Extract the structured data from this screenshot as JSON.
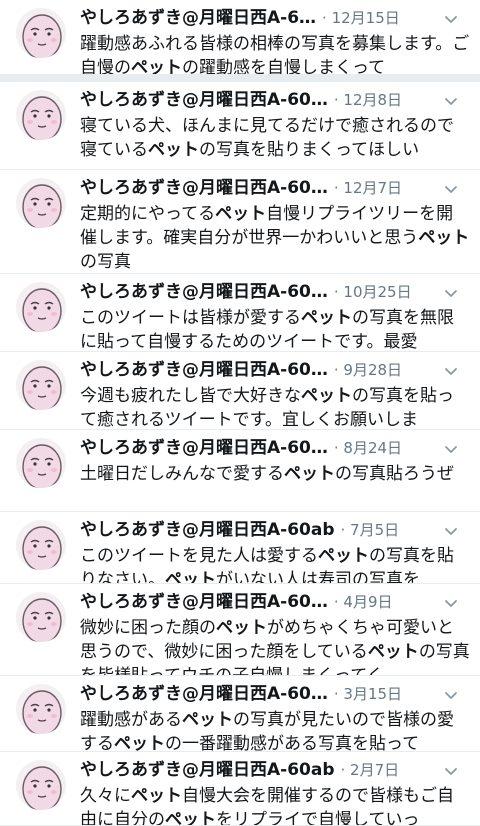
{
  "accent": "#657786",
  "tweets": [
    {
      "name": "やしろあずき@月曜日西A-6…",
      "date": "· 12月15日",
      "segments": [
        {
          "t": "躍動感あふれる皆様の相棒の写真を募集します。ご自慢の",
          "b": false
        },
        {
          "t": "ペット",
          "b": true
        },
        {
          "t": "の躍動感を自慢しまくって",
          "b": false
        }
      ]
    },
    {
      "name": "やしろあずき@月曜日西A-60…",
      "date": "· 12月8日",
      "segments": [
        {
          "t": "寝ている犬、ほんまに見てるだけで癒されるので寝ている",
          "b": false
        },
        {
          "t": "ペット",
          "b": true
        },
        {
          "t": "の写真を貼りまくってほしい",
          "b": false
        }
      ]
    },
    {
      "name": "やしろあずき@月曜日西A-60…",
      "date": "· 12月7日",
      "segments": [
        {
          "t": "定期的にやってる",
          "b": false
        },
        {
          "t": "ペット",
          "b": true
        },
        {
          "t": "自慢リプライツリーを開催します。確実自分が世界一かわいいと思う",
          "b": false
        },
        {
          "t": "ペット",
          "b": true
        },
        {
          "t": "の写真",
          "b": false
        }
      ]
    },
    {
      "name": "やしろあずき@月曜日西A-60…",
      "date": "· 10月25日",
      "segments": [
        {
          "t": "このツイートは皆様が愛する",
          "b": false
        },
        {
          "t": "ペット",
          "b": true
        },
        {
          "t": "の写真を無限に貼って自慢するためのツイートです。最愛",
          "b": false
        }
      ]
    },
    {
      "name": "やしろあずき@月曜日西A-60…",
      "date": "· 9月28日",
      "segments": [
        {
          "t": "今週も疲れたし皆で大好きな",
          "b": false
        },
        {
          "t": "ペット",
          "b": true
        },
        {
          "t": "の写真を貼って癒されるツイートです。宜しくお願いしま",
          "b": false
        }
      ]
    },
    {
      "name": "やしろあずき@月曜日西A-60…",
      "date": "· 8月24日",
      "segments": [
        {
          "t": "土曜日だしみんなで愛する",
          "b": false
        },
        {
          "t": "ペット",
          "b": true
        },
        {
          "t": "の写真貼ろうぜ",
          "b": false
        }
      ]
    },
    {
      "name": "やしろあずき@月曜日西A-60ab",
      "date": "· 7月5日",
      "segments": [
        {
          "t": "このツイートを見た人は愛する",
          "b": false
        },
        {
          "t": "ペット",
          "b": true
        },
        {
          "t": "の写真を貼りなさい。",
          "b": false
        },
        {
          "t": "ペット",
          "b": true
        },
        {
          "t": "がいない人は寿司の写真を",
          "b": false
        }
      ]
    },
    {
      "name": "やしろあずき@月曜日西A-60…",
      "date": "· 4月9日",
      "segments": [
        {
          "t": "微妙に困った顔の",
          "b": false
        },
        {
          "t": "ペット",
          "b": true
        },
        {
          "t": "がめちゃくちゃ可愛いと思うので、微妙に困った顔をしている",
          "b": false
        },
        {
          "t": "ペット",
          "b": true
        },
        {
          "t": "の写真を皆様貼ってウチの子自慢しまくってく",
          "b": false
        }
      ]
    },
    {
      "name": "やしろあずき@月曜日西A-60…",
      "date": "· 3月15日",
      "segments": [
        {
          "t": "躍動感がある",
          "b": false
        },
        {
          "t": "ペット",
          "b": true
        },
        {
          "t": "の写真が見たいので皆様の愛する",
          "b": false
        },
        {
          "t": "ペット",
          "b": true
        },
        {
          "t": "の一番躍動感がある写真を貼って",
          "b": false
        }
      ]
    },
    {
      "name": "やしろあずき@月曜日西A-60ab",
      "date": "· 2月7日",
      "segments": [
        {
          "t": "久々に",
          "b": false
        },
        {
          "t": "ペット",
          "b": true
        },
        {
          "t": "自慢大会を開催するので皆様もご自由に自分の",
          "b": false
        },
        {
          "t": "ペット",
          "b": true
        },
        {
          "t": "をリプライで自慢していっ",
          "b": false
        }
      ]
    }
  ]
}
